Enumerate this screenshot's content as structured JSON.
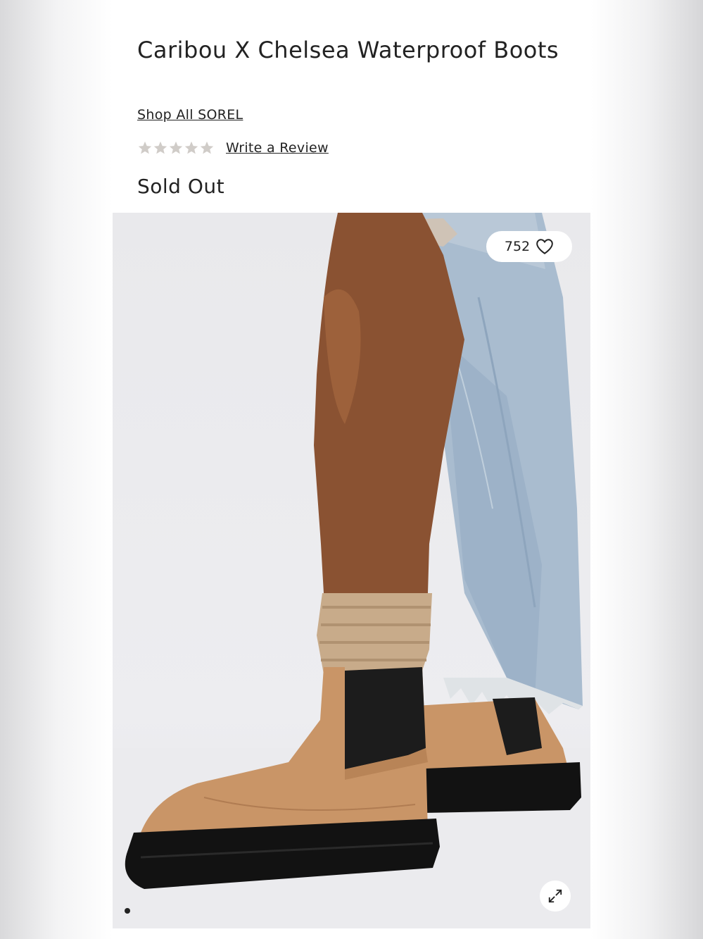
{
  "product": {
    "title": "Caribou X Chelsea Waterproof Boots",
    "brand_link": "Shop All SOREL",
    "rating_stars": 0,
    "rating_max": 5,
    "review_link": "Write a Review",
    "status": "Sold Out"
  },
  "gallery": {
    "favorites_count": "752",
    "heart_icon": "heart-outline-icon",
    "expand_icon": "expand-arrows-icon",
    "current_slide": 1
  },
  "colors": {
    "text": "#222222",
    "star_empty": "#d0ccc8",
    "boot_leather": "#c99567",
    "sole": "#121212"
  }
}
